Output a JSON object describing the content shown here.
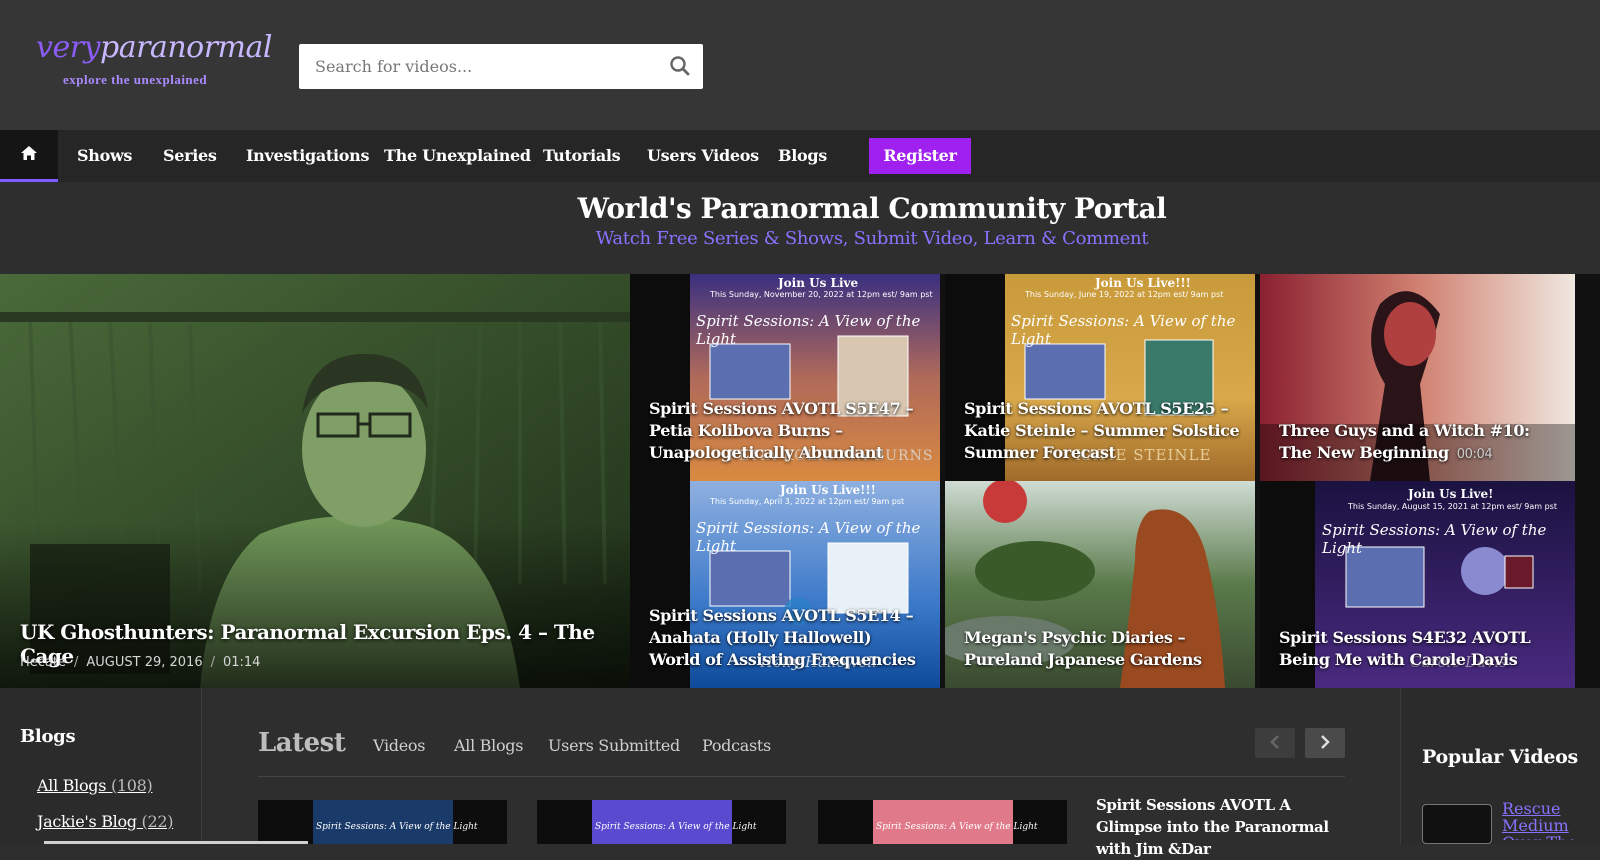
{
  "header": {
    "logo_part1": "very",
    "logo_part2": "paranormal",
    "logo_tagline": "explore the unexplained",
    "search_placeholder": "Search for videos..."
  },
  "nav": {
    "items": [
      "Shows",
      "Series",
      "Investigations",
      "The Unexplained",
      "Tutorials",
      "Users Videos",
      "Blogs"
    ],
    "register_label": "Register"
  },
  "hero": {
    "title": "World's Paranormal Community Portal",
    "subtitle": "Watch Free Series & Shows, Submit Video, Learn & Comment"
  },
  "featured": {
    "main": {
      "title": "UK Ghosthunters: Paranormal Excursion Eps. 4 – The Cage",
      "author": "Hecate",
      "date": "AUGUST 29, 2016",
      "duration": "01:14"
    },
    "tiles": [
      {
        "title": "Spirit Sessions AVOTL S5E47 – Petia Kolibova Burns – Unapologetically Abundant",
        "time": ""
      },
      {
        "title": "Spirit Sessions AVOTL S5E25 – Katie Steinle – Summer Solstice Summer Forecast",
        "time": ""
      },
      {
        "title": "Three Guys and a Witch #10: The New Beginning",
        "time": "00:04"
      },
      {
        "title": "Spirit Sessions AVOTL S5E14 – Anahata (Holly Hallowell) World of Assisting Frequencies",
        "time": ""
      },
      {
        "title": "Megan's Psychic Diaries – Pureland Japanese Gardens",
        "time": ""
      },
      {
        "title": "Spirit Sessions S4E32 AVOTL Being Me with Carole Davis",
        "time": ""
      }
    ],
    "thumb_texts": {
      "join_live": "Join Us Live",
      "join_live2": "Join Us Live!!!",
      "join_live3": "Join Us Live!",
      "session_title": "Spirit Sessions: A View of the Light",
      "name1": "PETIA KOLIBOVA BURNS",
      "name2": "KATIE STEINLE",
      "name3": "Holly Hallowell",
      "name4": "Carole Davis",
      "date1": "This Sunday, November 20, 2022 at 12pm est/ 9am pst",
      "date2": "This Sunday, June 19, 2022 at 12pm est/ 9am pst",
      "date3": "This Sunday, April 3, 2022 at 12pm est/ 9am pst",
      "date4": "This Sunday, August 15, 2021 at 12pm est/ 9am pst"
    }
  },
  "blogs_sidebar": {
    "heading": "Blogs",
    "links": [
      {
        "label": "All Blogs",
        "count": "(108)"
      },
      {
        "label": "Jackie's Blog",
        "count": "(22)"
      }
    ]
  },
  "latest": {
    "heading": "Latest",
    "tabs": [
      "Videos",
      "All Blogs",
      "Users Submitted",
      "Podcasts"
    ],
    "first_item_title": "Spirit Sessions AVOTL A Glimpse into the Paranormal with Jim &Dar",
    "thumb_label": "Spirit Sessions: A View of the Light"
  },
  "popular": {
    "heading": "Popular Videos",
    "first_link": "Rescue Medium Over The Rainbow"
  },
  "colors": {
    "accent": "#7c5cff",
    "register": "#a020f0",
    "subtitle": "#8a72ff",
    "background": "#2e2e2e"
  }
}
